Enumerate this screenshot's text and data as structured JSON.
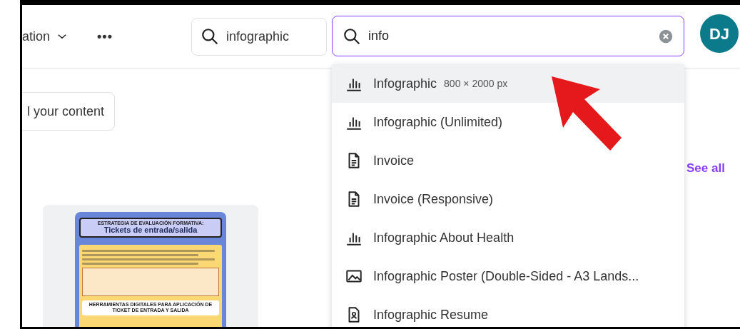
{
  "header": {
    "menu_label": "ation",
    "more_label": "•••",
    "search": {
      "value": "infographic"
    },
    "active_search": {
      "value": "info"
    },
    "avatar": "DJ"
  },
  "content": {
    "action_button": "l your content",
    "see_all": "See all",
    "thumbnail": {
      "kicker": "ESTRATEGIA DE EVALUACIÓN FORMATIVA:",
      "title": "Tickets de entrada/salida",
      "footer": "HERRAMIENTAS DIGITALES PARA APLICACIÓN DE TICKET DE ENTRADA Y SALIDA"
    }
  },
  "suggestions": [
    {
      "kind": "chart",
      "label": "Infographic",
      "detail": "800 × 2000 px",
      "selected": true
    },
    {
      "kind": "chart",
      "label": "Infographic (Unlimited)",
      "selected": false
    },
    {
      "kind": "document",
      "label": "Invoice",
      "selected": false
    },
    {
      "kind": "document",
      "label": "Invoice (Responsive)",
      "selected": false
    },
    {
      "kind": "chart",
      "label": "Infographic About Health",
      "selected": false
    },
    {
      "kind": "image",
      "label": "Infographic Poster (Double-Sided - A3 Lands...",
      "selected": false
    },
    {
      "kind": "resume",
      "label": "Infographic Resume",
      "selected": false
    }
  ]
}
